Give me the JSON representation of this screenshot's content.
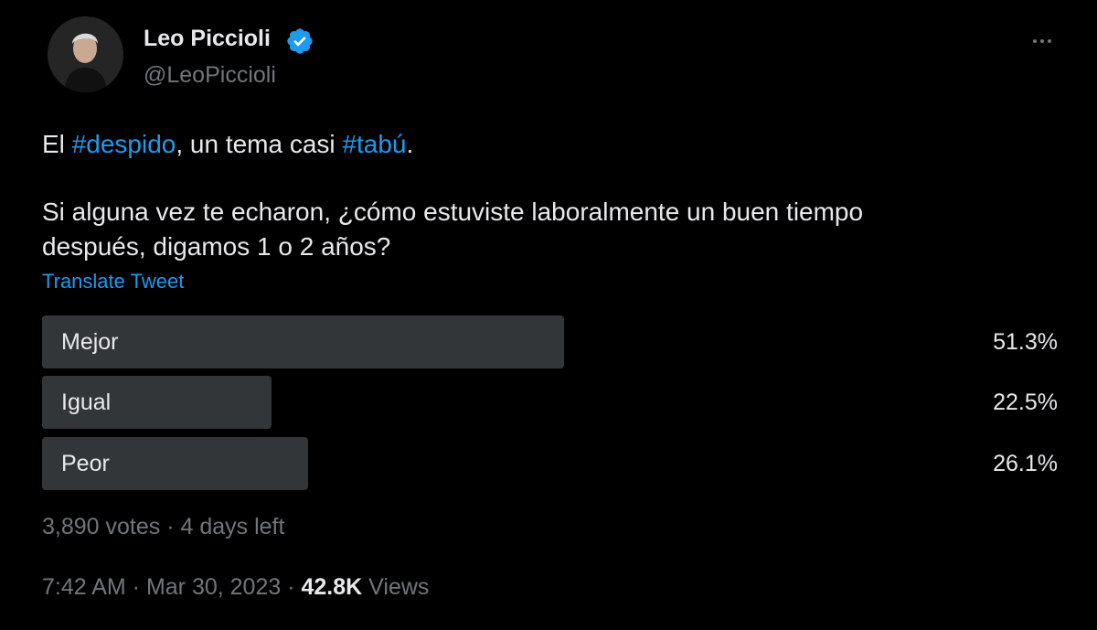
{
  "author": {
    "display_name": "Leo Piccioli",
    "handle": "@LeoPiccioli",
    "verified_icon": "verified-badge-icon",
    "avatar_icon": "user-avatar"
  },
  "more_icon": "more-horizontal-icon",
  "tweet": {
    "line1": {
      "part1": "El ",
      "hashtag1": "#despido",
      "part2": ", un tema casi ",
      "hashtag2": "#tabú",
      "part3": "."
    },
    "line2": "Si alguna vez te echaron, ¿cómo estuviste laboralmente un buen tiempo",
    "line3": "después, digamos 1 o 2 años?"
  },
  "translate_label": "Translate Tweet",
  "poll": {
    "options": [
      {
        "label": "Mejor",
        "percent_text": "51.3%",
        "fraction": 0.513
      },
      {
        "label": "Igual",
        "percent_text": "22.5%",
        "fraction": 0.225
      },
      {
        "label": "Peor",
        "percent_text": "26.1%",
        "fraction": 0.261
      }
    ],
    "votes": "3,890 votes",
    "separator": " · ",
    "time_left": "4 days left"
  },
  "meta": {
    "time": "7:42 AM",
    "separator": " · ",
    "date": "Mar 30, 2023",
    "views_count": "42.8K",
    "views_label": "Views"
  },
  "colors": {
    "background": "#000000",
    "text": "#e7e9ea",
    "secondary": "#71767b",
    "accent": "#1d9bf0",
    "poll_bar": "#333639"
  }
}
